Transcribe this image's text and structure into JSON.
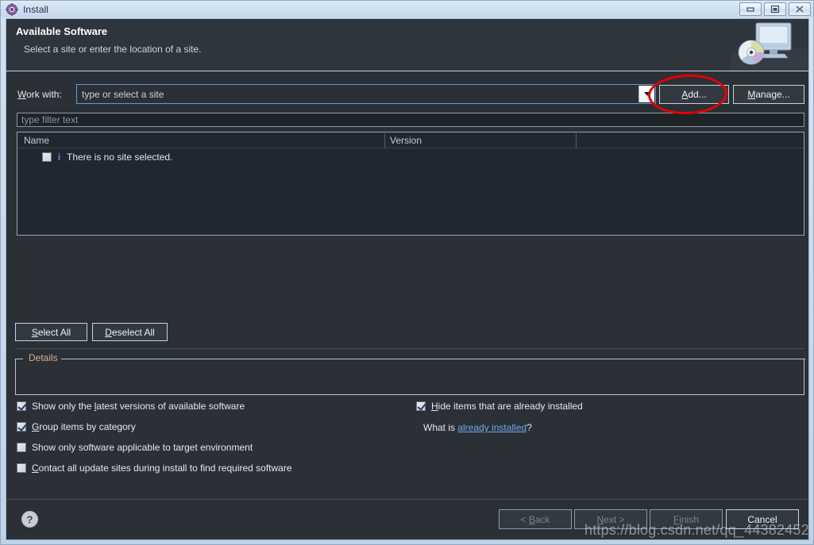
{
  "window": {
    "title": "Install",
    "icon": "gear-icon",
    "controls": {
      "minimize": "minimize-icon",
      "maximize": "maximize-icon",
      "close": "close-icon"
    }
  },
  "banner": {
    "title": "Available Software",
    "subtitle": "Select a site or enter the location of a site.",
    "graphic": "monitor-with-disc-icon"
  },
  "workwith": {
    "label": "Work with:",
    "label_mnemonic": "W",
    "value": "",
    "placeholder": "type or select a site",
    "dropdown_icon": "chevron-down-icon",
    "add_button": "Add...",
    "add_mnemonic": "A",
    "manage_button": "Manage...",
    "manage_mnemonic": "M"
  },
  "filter": {
    "value": "",
    "placeholder": "type filter text"
  },
  "table": {
    "columns": [
      "Name",
      "Version",
      ""
    ],
    "rows": [
      {
        "checked": false,
        "icon": "info-icon",
        "name": "There is no site selected.",
        "version": ""
      }
    ]
  },
  "list_buttons": {
    "select_all": "Select All",
    "select_all_mnemonic": "S",
    "deselect_all": "Deselect All",
    "deselect_all_mnemonic": "D"
  },
  "details": {
    "label": "Details",
    "text": ""
  },
  "options": {
    "left": [
      {
        "label": "Show only the latest versions of available software",
        "checked": true,
        "mnemonic": "l"
      },
      {
        "label": "Group items by category",
        "checked": true,
        "mnemonic": "G"
      },
      {
        "label": "Show only software applicable to target environment",
        "checked": false,
        "mnemonic": ""
      },
      {
        "label": "Contact all update sites during install to find required software",
        "checked": false,
        "mnemonic": "C"
      }
    ],
    "right": [
      {
        "label": "Hide items that are already installed",
        "checked": true,
        "mnemonic": "H"
      }
    ],
    "whatis_prefix": "What is ",
    "whatis_link": "already installed",
    "whatis_suffix": "?"
  },
  "footer": {
    "help_icon": "help-icon",
    "buttons": [
      {
        "label": "< Back",
        "enabled": false,
        "mnemonic": "B"
      },
      {
        "label": "Next >",
        "enabled": false,
        "mnemonic": "N"
      },
      {
        "label": "Finish",
        "enabled": false,
        "mnemonic": "F"
      },
      {
        "label": "Cancel",
        "enabled": true,
        "mnemonic": ""
      }
    ]
  },
  "annotation": {
    "shape": "ellipse",
    "color": "#e60000",
    "target": "Add... button"
  },
  "watermark": "https://blog.csdn.net/qq_44382452",
  "colors": {
    "dialog_bg": "#2b3036",
    "banner_bg": "#2f353c",
    "table_bg": "#212730",
    "text": "#e3e9ef",
    "link": "#6fa8e8",
    "accent_focus": "#5b9fd4",
    "group_label": "#d8b08a",
    "annotation": "#e60000"
  }
}
